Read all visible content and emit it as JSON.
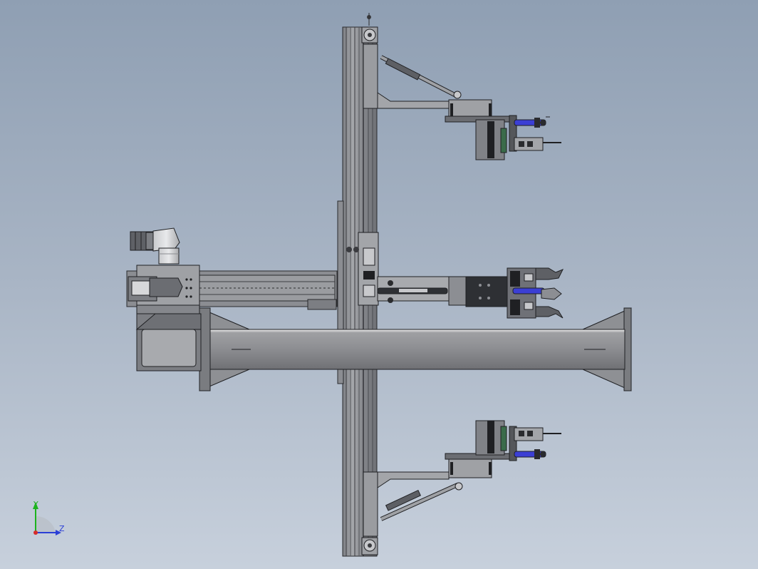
{
  "view": {
    "background_top": "#8f9fb3",
    "background_bottom": "#c7d0dc"
  },
  "triad": {
    "y_label": "Y",
    "z_label": "Z",
    "y_color": "#1db31d",
    "z_color": "#2b3fd6",
    "x_color": "#d62b2b"
  },
  "model": {
    "frame_color": "#8a8c93",
    "dark_color": "#2b2d31",
    "cylinder_color": "#3b3fd4",
    "gripper_color": "#6f7177"
  }
}
